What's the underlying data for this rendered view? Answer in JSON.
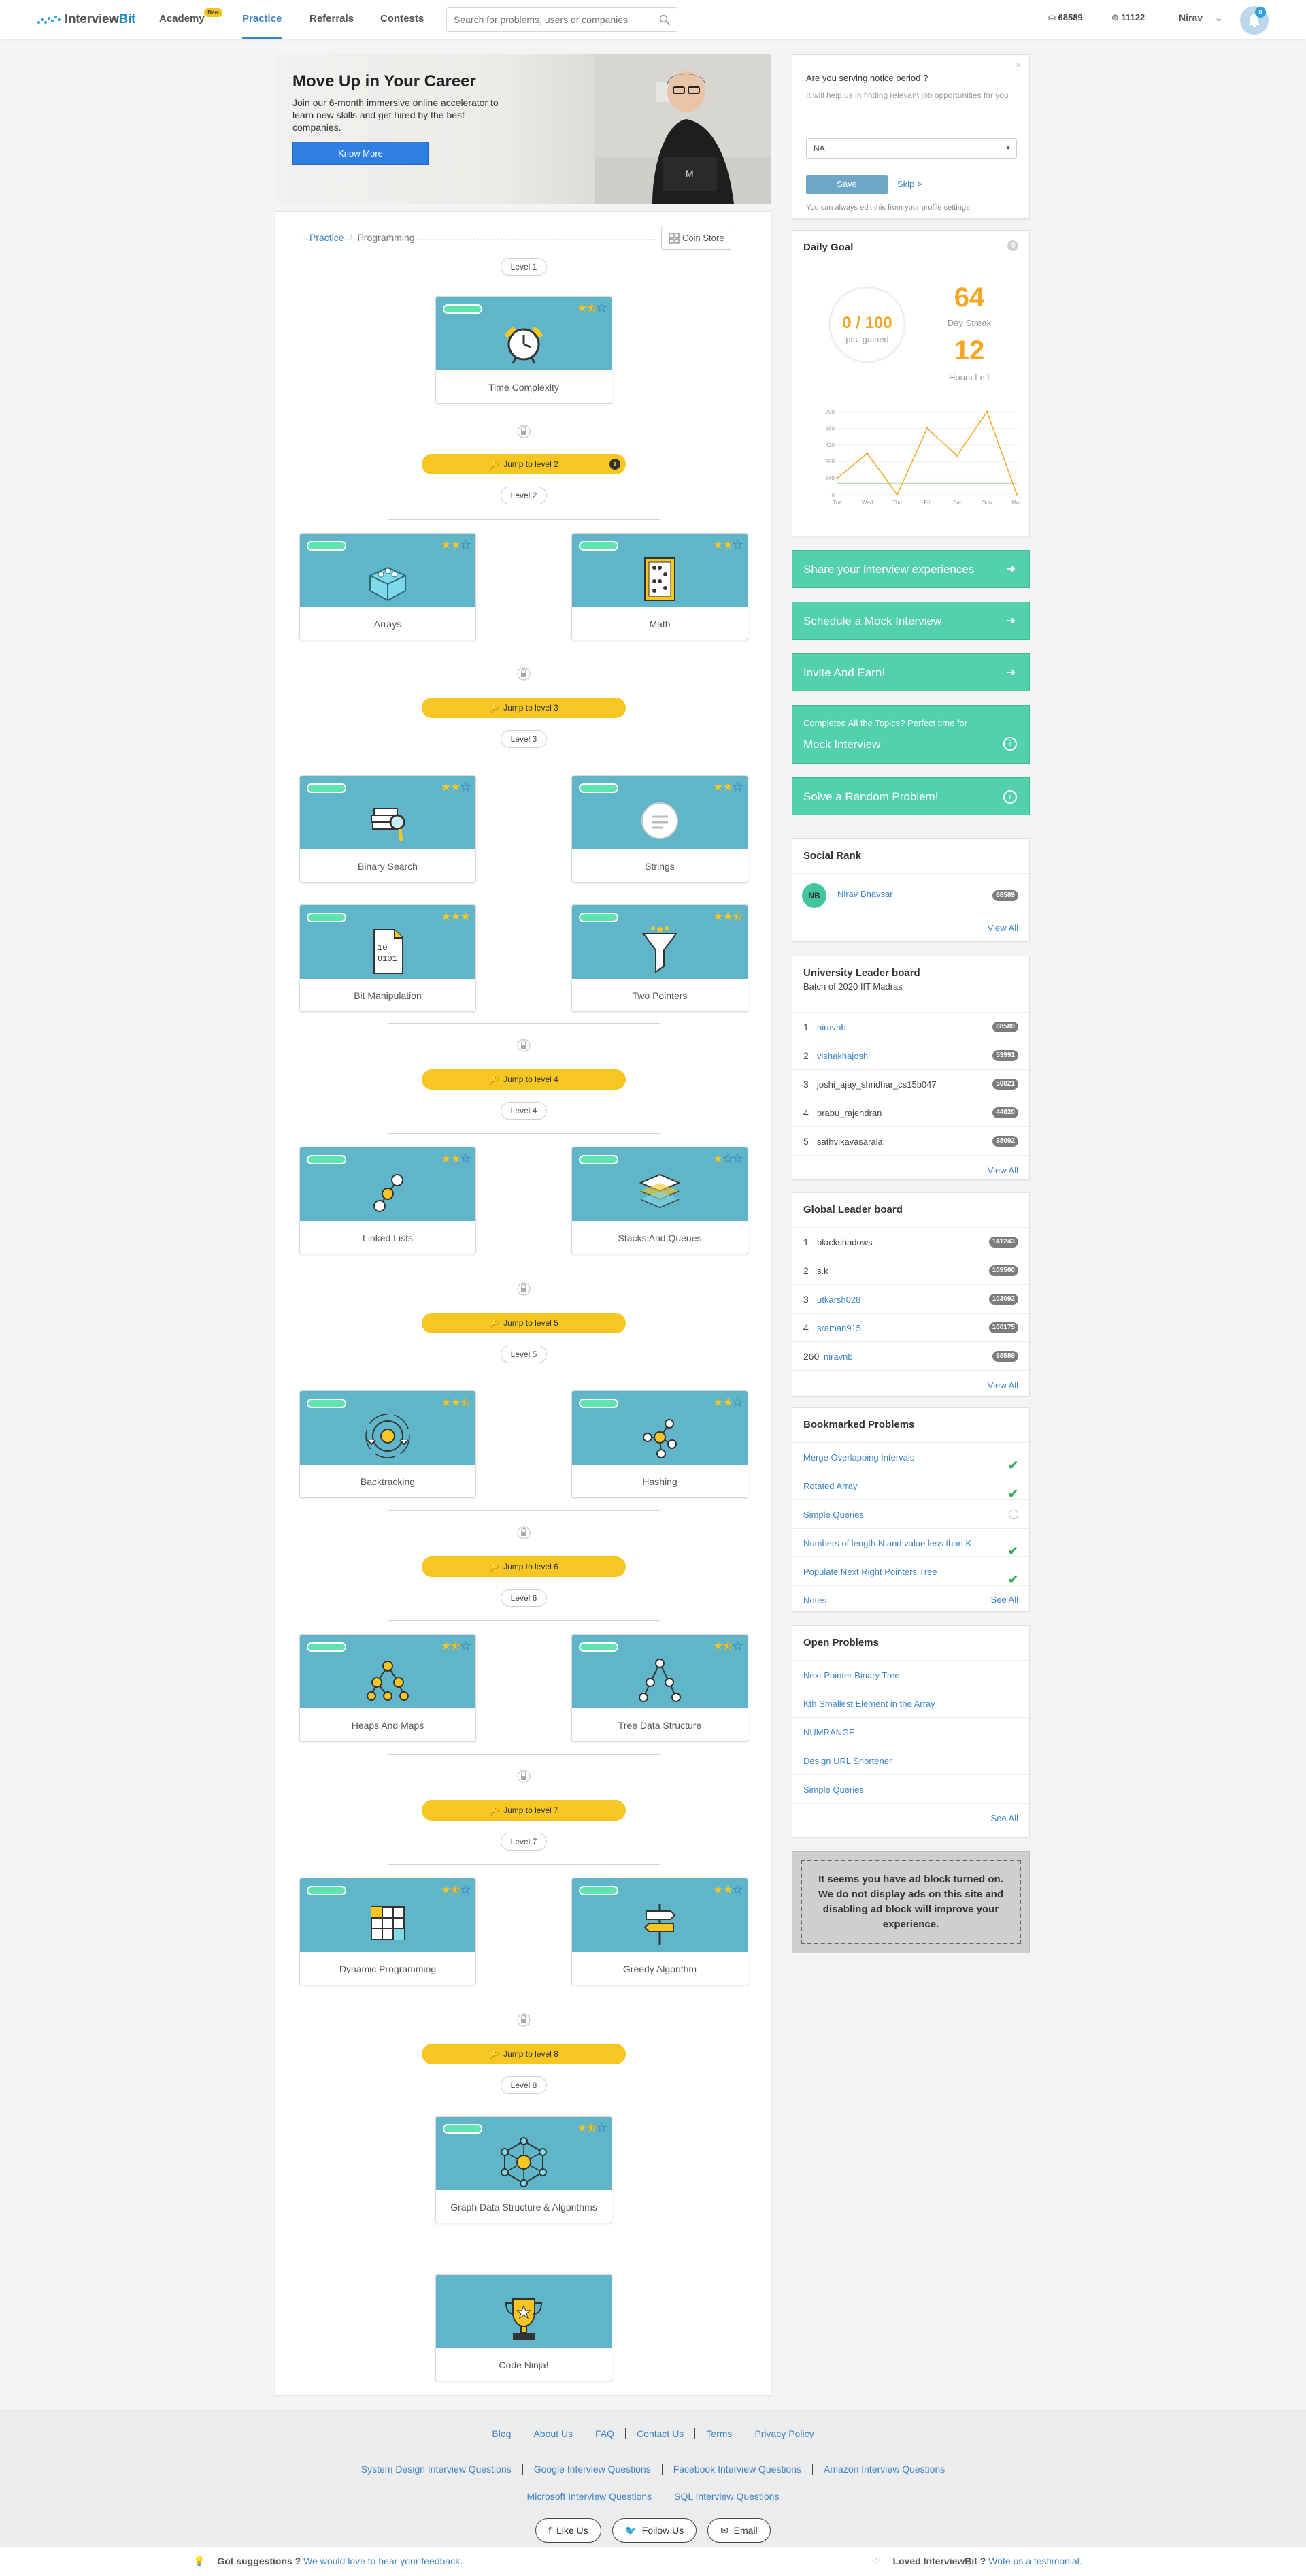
{
  "nav": {
    "logo_a": "Interview",
    "logo_b": "Bit",
    "items": [
      "Academy",
      "Practice",
      "Referrals",
      "Contests"
    ],
    "academy_badge": "New",
    "search_placeholder": "Search for problems, users or companies",
    "coins": "68589",
    "points": "11122",
    "user": "Nirav",
    "notifications": "0"
  },
  "banner": {
    "title": "Move Up in Your Career",
    "text": "Join our 6-month immersive online accelerator to learn new skills and get hired by the best companies.",
    "button": "Know More"
  },
  "breadcrumb": {
    "root": "Practice",
    "current": "Programming"
  },
  "coin_store": "Coin Store",
  "levels": {
    "l1": "Level 1",
    "l2": "Level 2",
    "l3": "Level 3",
    "l4": "Level 4",
    "l5": "Level 5",
    "l6": "Level 6",
    "l7": "Level 7",
    "l8": "Level 8"
  },
  "jumps": {
    "j2": "Jump to level 2",
    "j3": "Jump to level 3",
    "j4": "Jump to level 4",
    "j5": "Jump to level 5",
    "j6": "Jump to level 6",
    "j7": "Jump to level 7",
    "j8": "Jump to level 8"
  },
  "topics": {
    "time_complexity": {
      "label": "Time Complexity",
      "stars": 1.5
    },
    "arrays": {
      "label": "Arrays",
      "stars": 2
    },
    "math": {
      "label": "Math",
      "stars": 2
    },
    "binary_search": {
      "label": "Binary Search",
      "stars": 2
    },
    "strings": {
      "label": "Strings",
      "stars": 2
    },
    "bit_manipulation": {
      "label": "Bit Manipulation",
      "stars": 3
    },
    "two_pointers": {
      "label": "Two Pointers",
      "stars": 2.5
    },
    "linked_lists": {
      "label": "Linked Lists",
      "stars": 2
    },
    "stacks_queues": {
      "label": "Stacks And Queues",
      "stars": 1
    },
    "backtracking": {
      "label": "Backtracking",
      "stars": 2.5
    },
    "hashing": {
      "label": "Hashing",
      "stars": 2
    },
    "heaps_maps": {
      "label": "Heaps And Maps",
      "stars": 1.5
    },
    "tree_ds": {
      "label": "Tree Data Structure",
      "stars": 1.5
    },
    "dp": {
      "label": "Dynamic Programming",
      "stars": 1.5
    },
    "greedy": {
      "label": "Greedy Algorithm",
      "stars": 2
    },
    "graph": {
      "label": "Graph Data Structure & Algorithms",
      "stars": 1.5
    },
    "code_ninja": {
      "label": "Code Ninja!"
    }
  },
  "notice": {
    "question": "Are you serving notice period ?",
    "help": "It will help us in finding relevant job opportunities for you",
    "select_value": "NA",
    "save": "Save",
    "skip": "Skip >",
    "note": "You can always edit this from your profile settings"
  },
  "daily_goal": {
    "title": "Daily Goal",
    "score": "0 / 100",
    "score_sub": "pts. gained",
    "streak": "64",
    "streak_label": "Day Streak",
    "hours": "12",
    "hours_label": "Hours Left",
    "chart": {
      "days": [
        "Tue",
        "Wed",
        "Thu",
        "Fri",
        "Sat",
        "Sun",
        "Mon"
      ],
      "yticks": [
        "700",
        "560",
        "420",
        "280",
        "140",
        "0"
      ],
      "values": [
        140,
        350,
        0,
        560,
        330,
        700,
        0
      ],
      "goal": 100,
      "colors": {
        "line": "#f5a623",
        "goal": "#4caf50"
      }
    }
  },
  "actions": {
    "share": "Share your interview experiences",
    "mock": "Schedule a Mock Interview",
    "invite": "Invite And Earn!",
    "completed_line1": "Completed All the Topics? Perfect time for",
    "completed_line2": "Mock Interview",
    "random": "Solve a Random Problem!"
  },
  "social_rank": {
    "title": "Social Rank",
    "initials": "NB",
    "name": "Nirav Bhavsar",
    "points": "68589",
    "view_all": "View All"
  },
  "university": {
    "title": "University Leader board",
    "subtitle": "Batch of 2020 IIT Madras",
    "rows": [
      {
        "rank": "1",
        "name": "niravnb",
        "points": "68589",
        "link": true
      },
      {
        "rank": "2",
        "name": "vishakhajoshi",
        "points": "53991",
        "link": true
      },
      {
        "rank": "3",
        "name": "joshi_ajay_shridhar_cs15b047",
        "points": "50821",
        "link": false
      },
      {
        "rank": "4",
        "name": "prabu_rajendran",
        "points": "44820",
        "link": false
      },
      {
        "rank": "5",
        "name": "sathvikavasarala",
        "points": "38092",
        "link": false
      }
    ],
    "view_all": "View All"
  },
  "global": {
    "title": "Global Leader board",
    "rows": [
      {
        "rank": "1",
        "name": "blackshadows",
        "points": "141243",
        "link": false
      },
      {
        "rank": "2",
        "name": "s.k",
        "points": "109560",
        "link": false
      },
      {
        "rank": "3",
        "name": "utkarsh028",
        "points": "103092",
        "link": true
      },
      {
        "rank": "4",
        "name": "sraman915",
        "points": "100175",
        "link": true
      },
      {
        "rank": "260",
        "name": "niravnb",
        "points": "68589",
        "link": true
      }
    ],
    "view_all": "View All"
  },
  "bookmarked": {
    "title": "Bookmarked Problems",
    "items": [
      {
        "name": "Merge Overlapping Intervals",
        "status": "solved"
      },
      {
        "name": "Rotated Array",
        "status": "solved"
      },
      {
        "name": "Simple Queries",
        "status": "pending"
      },
      {
        "name": "Numbers of length N and value less than K",
        "status": "solved"
      },
      {
        "name": "Populate Next Right Pointers Tree",
        "status": "solved"
      }
    ],
    "notes": "Notes",
    "see_all": "See All"
  },
  "open_problems": {
    "title": "Open Problems",
    "items": [
      "Next Pointer Binary Tree",
      "Kth Smallest Element in the Array",
      "NUMRANGE",
      "Design URL Shortener",
      "Simple Queries"
    ],
    "see_all": "See All"
  },
  "adblock": "It seems you have ad block turned on. We do not display ads on this site and disabling ad block will improve your experience.",
  "footer": {
    "links1": [
      "Blog",
      "About Us",
      "FAQ",
      "Contact Us",
      "Terms",
      "Privacy Policy"
    ],
    "links2": [
      "System Design Interview Questions",
      "Google Interview Questions",
      "Facebook Interview Questions",
      "Amazon Interview Questions"
    ],
    "links3": [
      "Microsoft Interview Questions",
      "SQL Interview Questions"
    ],
    "social": [
      "Like Us",
      "Follow Us",
      "Email"
    ],
    "suggest_q": "Got suggestions ?",
    "suggest_link": "We would love to hear your feedback.",
    "loved_q": "Loved InterviewBit ?",
    "loved_link": "Write us a testimonial."
  }
}
